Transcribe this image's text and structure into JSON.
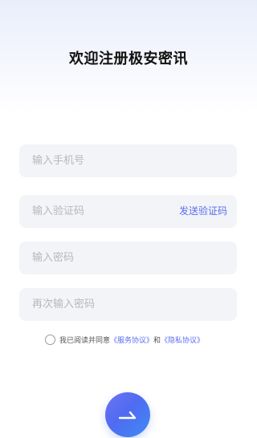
{
  "header": {
    "title": "欢迎注册极安密讯"
  },
  "form": {
    "phone_placeholder": "输入手机号",
    "code_placeholder": "输入验证码",
    "send_code_label": "发送验证码",
    "password_placeholder": "输入密码",
    "confirm_password_placeholder": "再次输入密码"
  },
  "agreement": {
    "checked": false,
    "prefix": "我已阅读并同意",
    "service_link": "《服务协议》",
    "conjunction": "和",
    "privacy_link": "《隐私协议》"
  },
  "submit": {
    "icon": "arrow-right-icon"
  },
  "colors": {
    "accent": "#5a6df0",
    "field_bg": "#f3f4f7",
    "placeholder": "#b6b8bd"
  }
}
